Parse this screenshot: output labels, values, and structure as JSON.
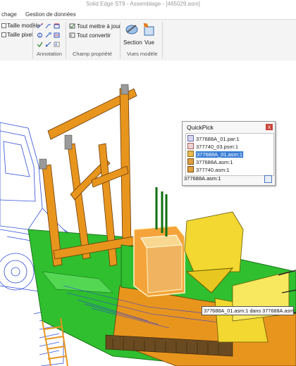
{
  "window": {
    "title": "Solid Edge ST9 - Assemblage - [465029.asm]"
  },
  "menu": {
    "items": [
      "chage",
      "Gestion de données"
    ]
  },
  "ribbon": {
    "left_options": [
      "Taille modèle",
      "Taille pixel"
    ],
    "groups": [
      "Annotation",
      "Champ propriété",
      "Vues modèle"
    ],
    "champ_buttons": [
      "Tout mettre à jour",
      "Tout convertir"
    ],
    "vues_buttons": [
      "Section",
      "Vue"
    ]
  },
  "quickpick": {
    "title": "QuickPick",
    "close": "x",
    "items": [
      {
        "label": "377688A_01.par:1",
        "icon": "part-icon"
      },
      {
        "label": "377740_03.psm:1",
        "icon": "sheetmetal-icon"
      },
      {
        "label": "377688A_01.asm:1",
        "icon": "assembly-icon",
        "selected": true
      },
      {
        "label": "377688A.asm:1",
        "icon": "assembly-icon"
      },
      {
        "label": "377740.asm:1",
        "icon": "assembly-icon"
      }
    ],
    "status": "377688A.asm:1"
  },
  "tooltip": {
    "text": "377688A_01.asm:1 dans 377688A.asm:1"
  },
  "colors": {
    "ribbon_bg": "#f4f4f4",
    "selection": "#3b7fd6",
    "model_green": "#2fbf2f",
    "model_orange": "#e8951e",
    "model_yellow": "#f2d830",
    "wire_blue": "#3050d8"
  }
}
